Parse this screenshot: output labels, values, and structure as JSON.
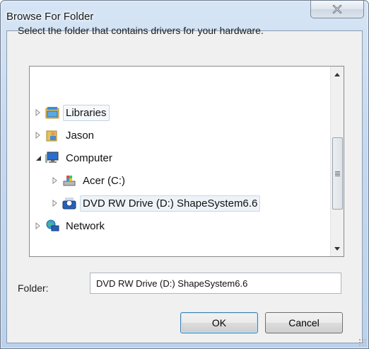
{
  "window": {
    "title": "Browse For Folder"
  },
  "instruction": "Select the folder that contains drivers for your hardware.",
  "tree": {
    "items": [
      {
        "label": "Libraries",
        "icon": "libraries-icon",
        "expander": "collapsed"
      },
      {
        "label": "Jason",
        "icon": "user-folder-icon",
        "expander": "collapsed"
      },
      {
        "label": "Computer",
        "icon": "computer-icon",
        "expander": "expanded"
      },
      {
        "label": "Acer (C:)",
        "icon": "hard-drive-icon",
        "expander": "collapsed"
      },
      {
        "label": "DVD RW Drive (D:) ShapeSystem6.6",
        "icon": "dvd-drive-icon",
        "expander": "collapsed",
        "selected": true
      },
      {
        "label": "Network",
        "icon": "network-icon",
        "expander": "collapsed"
      }
    ]
  },
  "folder": {
    "label": "Folder:",
    "value": "DVD RW Drive (D:) ShapeSystem6.6"
  },
  "buttons": {
    "ok": "OK",
    "cancel": "Cancel"
  },
  "colors": {
    "titlebar": "#c5d9ef",
    "client": "#f0f0f0",
    "selection_border": "#c9d7e6"
  }
}
